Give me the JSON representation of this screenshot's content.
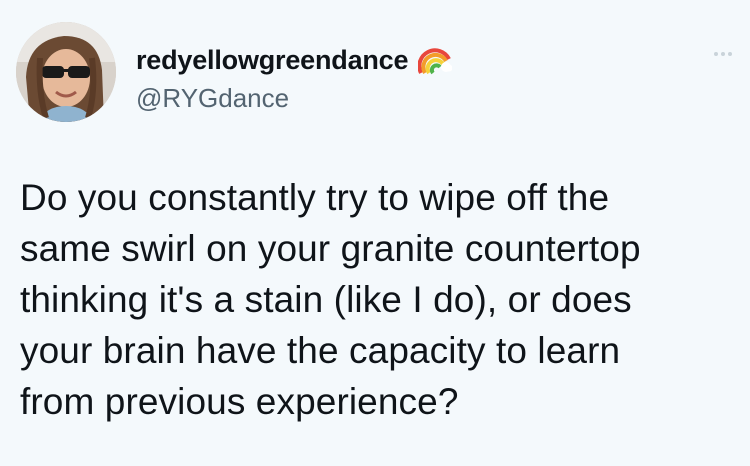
{
  "author": {
    "display_name": "redyellowgreendance",
    "handle": "@RYGdance",
    "badge_icon": "rainbow-emoji",
    "avatar_icon": "profile-photo"
  },
  "menu": {
    "icon": "more-options-icon"
  },
  "tweet": {
    "text": "Do you constantly try to wipe off the\nsame swirl on your granite countertop\nthinking it's a stain (like I do), or does\nyour brain have the capacity to learn\nfrom previous experience?"
  },
  "colors": {
    "background": "#f4f9fc",
    "text": "#0f1419",
    "handle": "#536471"
  }
}
